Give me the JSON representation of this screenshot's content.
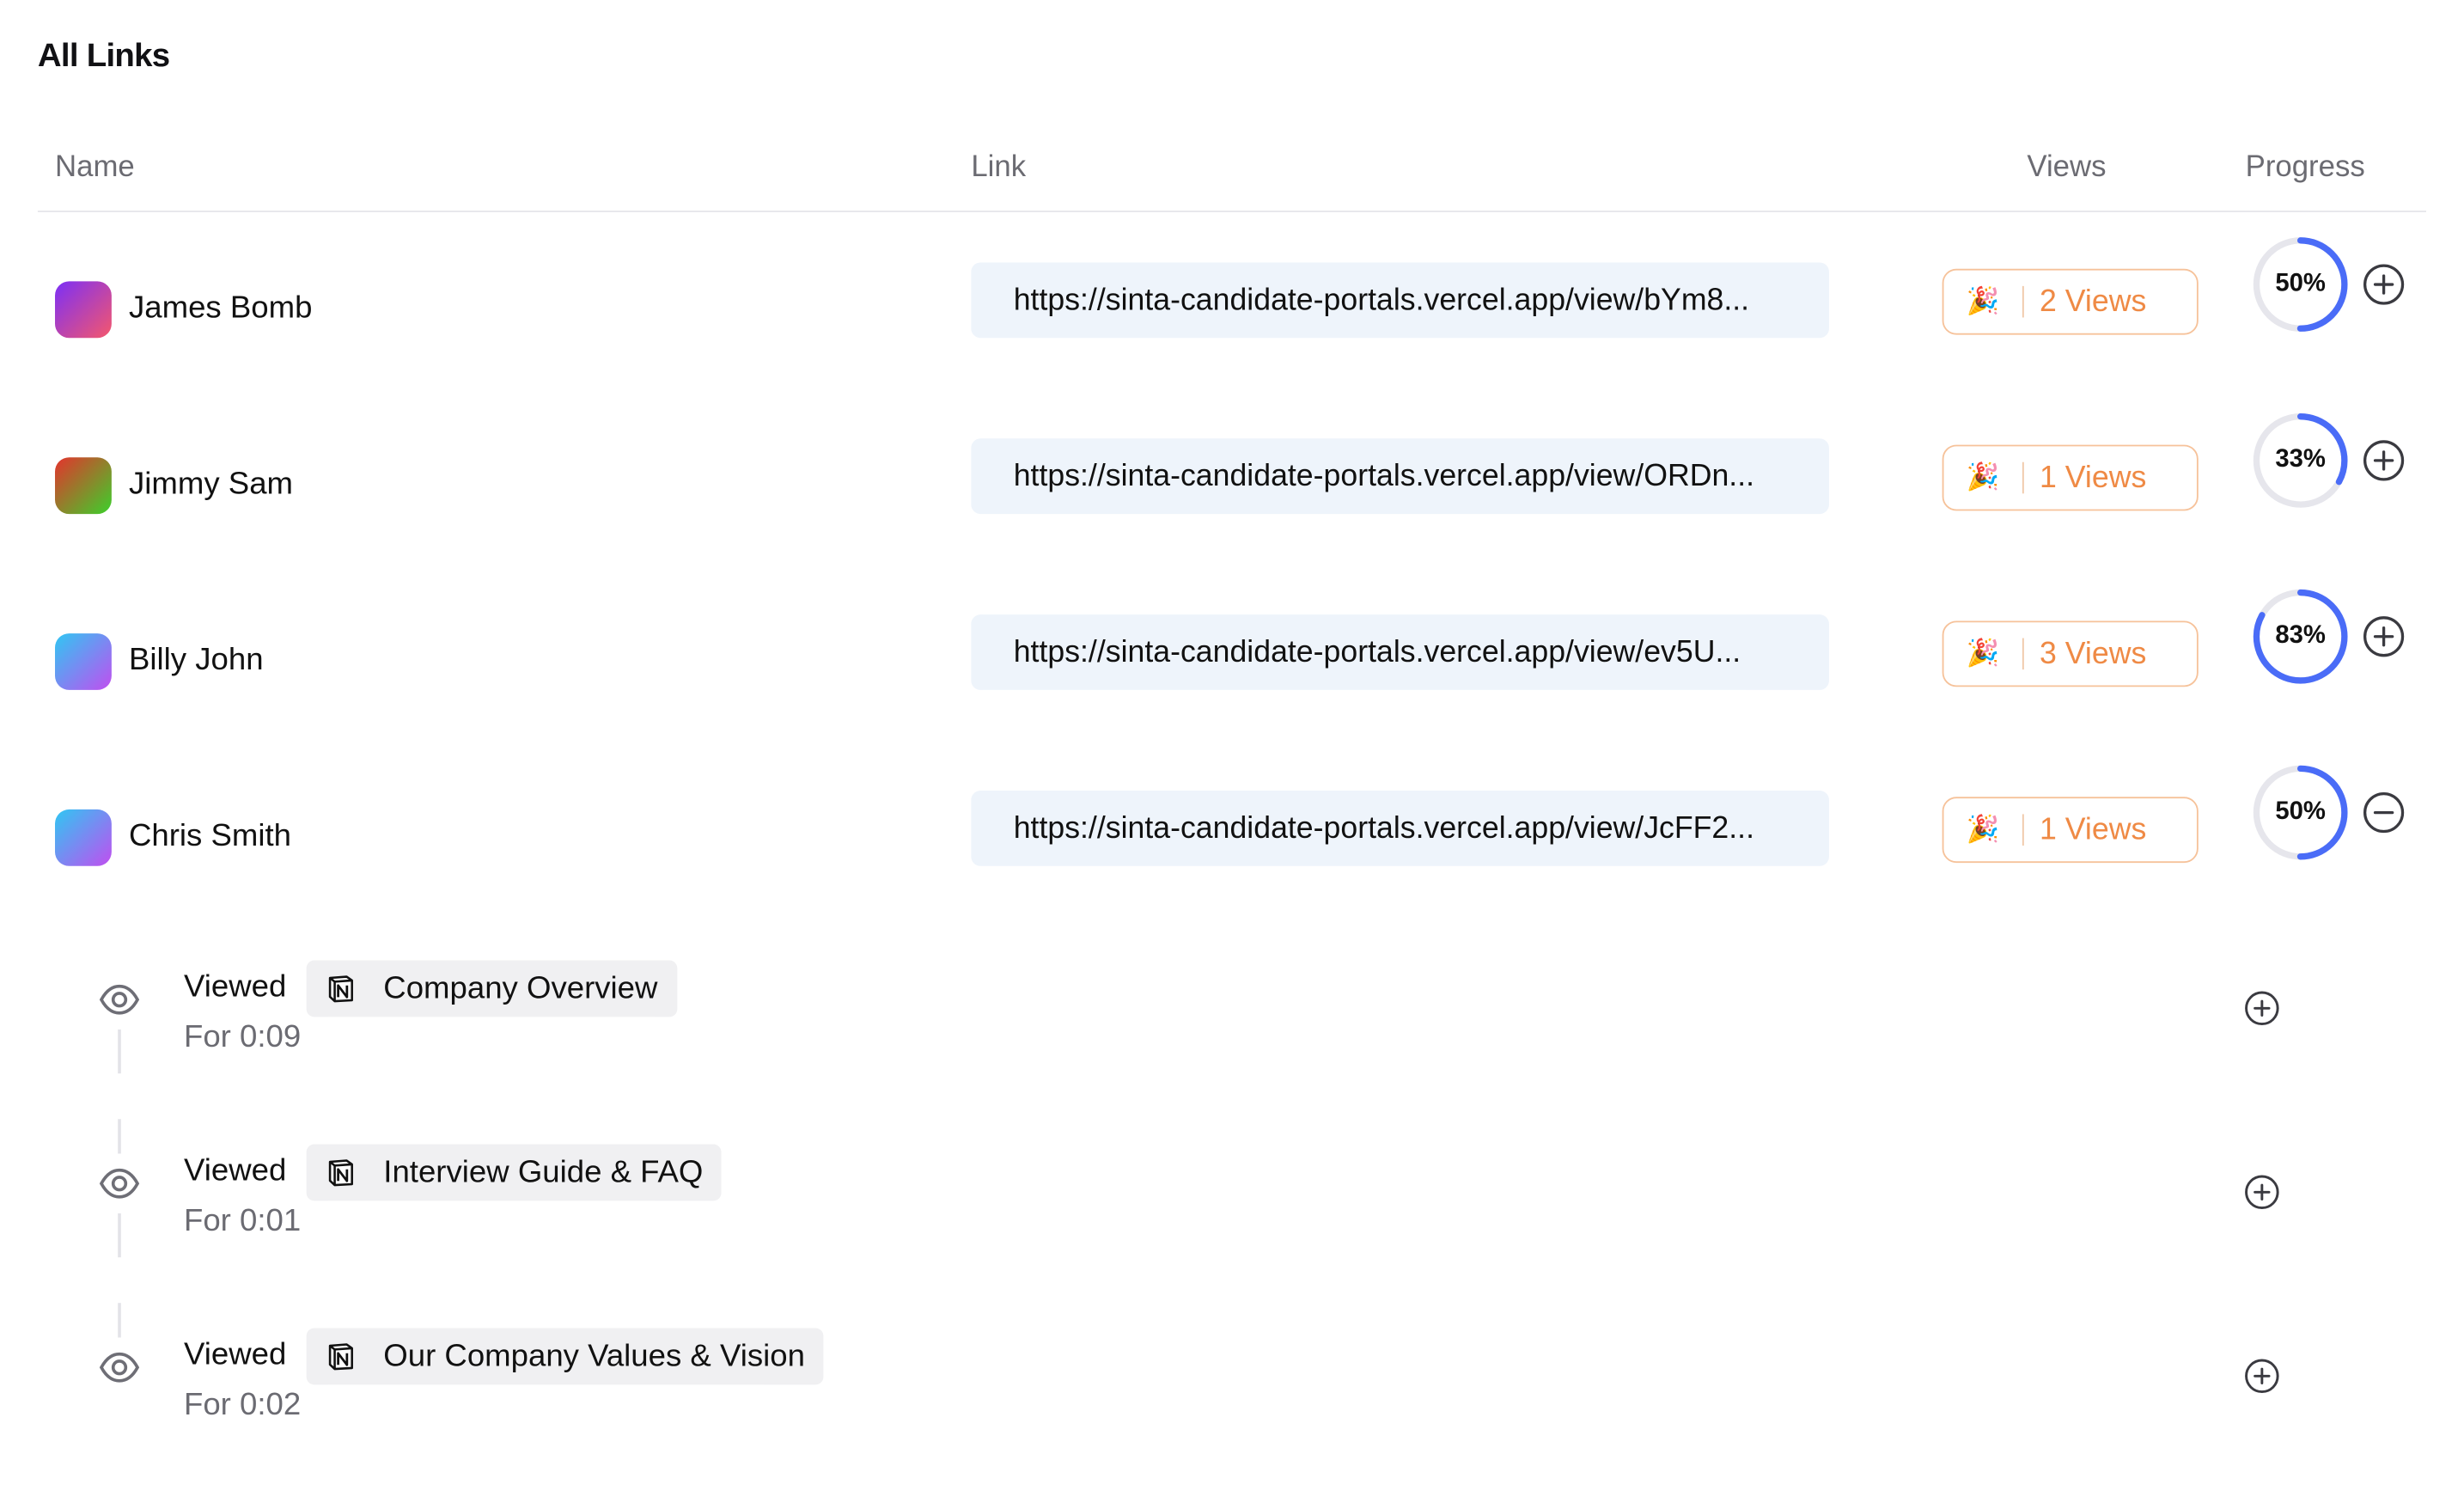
{
  "page": {
    "title": "All Links"
  },
  "table": {
    "headers": {
      "name": "Name",
      "link": "Link",
      "views": "Views",
      "progress": "Progress"
    },
    "rows": [
      {
        "name": "James Bomb",
        "avatar_colors": [
          "#7b2ff7",
          "#f5576c"
        ],
        "link": "https://sinta-candidate-portals.vercel.app/view/bYm8...",
        "views_emoji": "🎉",
        "views_label": "2 Views",
        "progress_label": "50%",
        "progress_fraction": 0.5,
        "toggle_icon": "plus-circle-icon"
      },
      {
        "name": "Jimmy Sam",
        "avatar_colors": [
          "#e5322d",
          "#3bd12b"
        ],
        "link": "https://sinta-candidate-portals.vercel.app/view/ORDn...",
        "views_emoji": "🎉",
        "views_label": "1 Views",
        "progress_label": "33%",
        "progress_fraction": 0.33,
        "toggle_icon": "plus-circle-icon"
      },
      {
        "name": "Billy John",
        "avatar_colors": [
          "#2fc7f3",
          "#c14ef0"
        ],
        "link": "https://sinta-candidate-portals.vercel.app/view/ev5U...",
        "views_emoji": "🎉",
        "views_label": "3 Views",
        "progress_label": "83%",
        "progress_fraction": 0.83,
        "toggle_icon": "plus-circle-icon"
      },
      {
        "name": "Chris Smith",
        "avatar_colors": [
          "#2fc7f3",
          "#c14ef0"
        ],
        "link": "https://sinta-candidate-portals.vercel.app/view/JcFF2...",
        "views_emoji": "🎉",
        "views_label": "1 Views",
        "progress_label": "50%",
        "progress_fraction": 0.5,
        "toggle_icon": "minus-circle-icon"
      }
    ]
  },
  "activity": [
    {
      "viewed_label": "Viewed",
      "doc_icon": "notion-icon",
      "doc_title": "Company Overview",
      "duration": "For 0:09"
    },
    {
      "viewed_label": "Viewed",
      "doc_icon": "notion-icon",
      "doc_title": "Interview Guide & FAQ",
      "duration": "For 0:01"
    },
    {
      "viewed_label": "Viewed",
      "doc_icon": "notion-icon",
      "doc_title": "Our Company Values & Vision",
      "duration": "For 0:02"
    }
  ],
  "colors": {
    "accent": "#4a6cf7",
    "ring_track": "#e6e6ec",
    "views_text": "#ef8a45",
    "views_border": "#f6c29a",
    "link_bg": "#eef4fb"
  }
}
